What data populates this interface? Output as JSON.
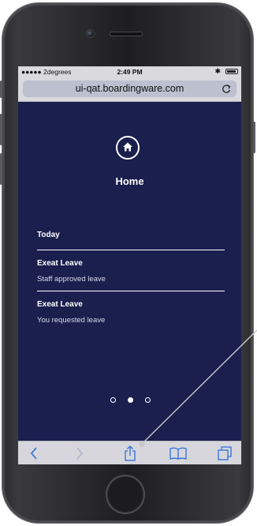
{
  "status_bar": {
    "carrier": "●●●●● 2degrees",
    "time": "2:49 PM",
    "bluetooth": "✱"
  },
  "browser": {
    "url": "ui-qat.boardingware.com",
    "reload_icon": "reload-icon"
  },
  "page": {
    "title": "Home",
    "icon": "home-icon"
  },
  "feed": {
    "header": "Today",
    "items": [
      {
        "title": "Exeat Leave",
        "subtitle": "Staff approved leave"
      },
      {
        "title": "Exeat Leave",
        "subtitle": "You requested leave"
      }
    ]
  },
  "pager": {
    "count": 3,
    "active": 1
  },
  "toolbar": {
    "icons": [
      "back-icon",
      "forward-icon",
      "share-icon",
      "bookmarks-icon",
      "tabs-icon"
    ]
  },
  "colors": {
    "app_background": "#1b1f4e",
    "browser_chrome": "#d9d9de",
    "url_field": "#bcc0cf",
    "toolbar_accent": "#2f6fdc"
  }
}
